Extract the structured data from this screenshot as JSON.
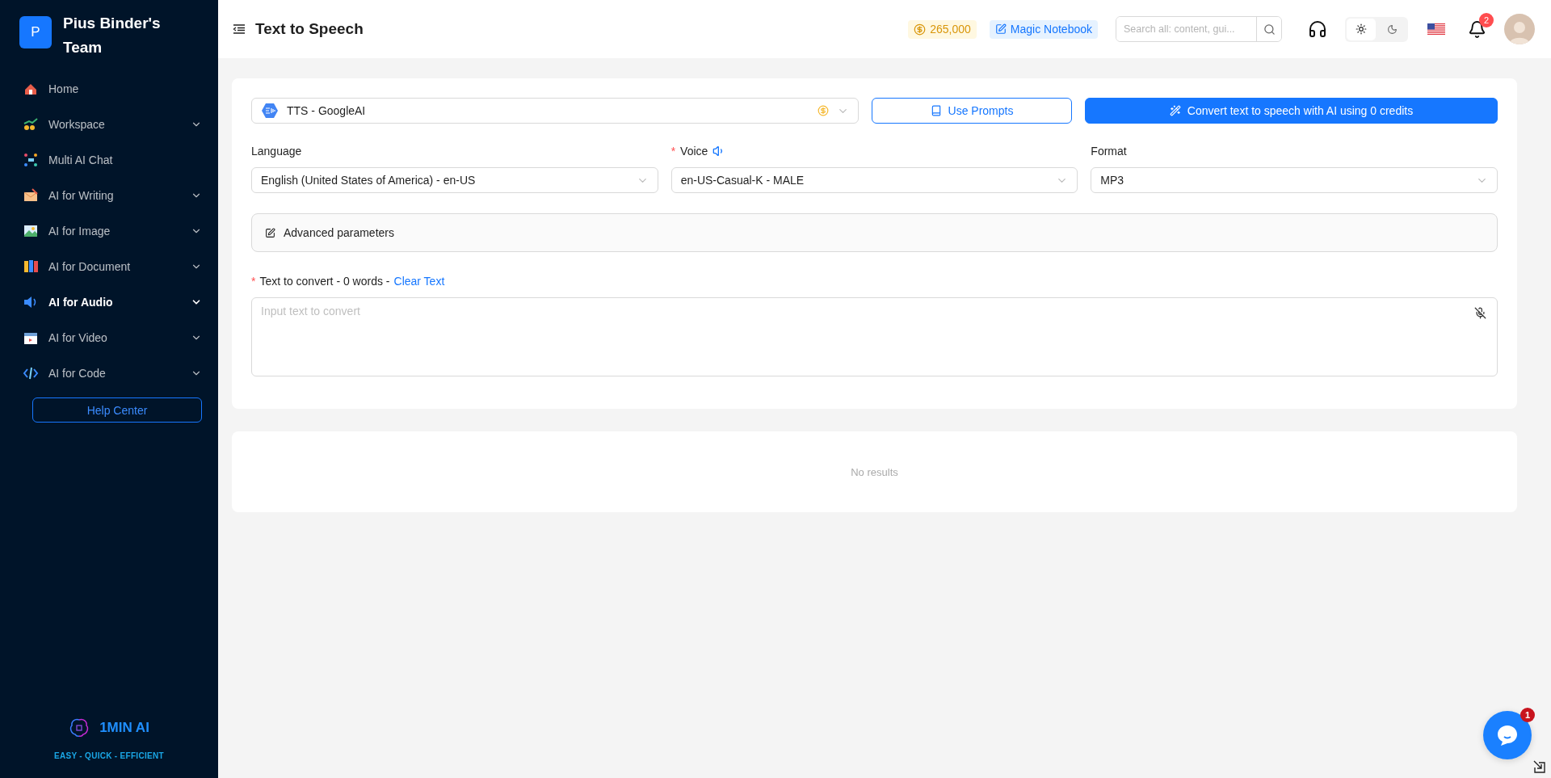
{
  "sidebar": {
    "team_initial": "P",
    "team_name": "Pius Binder's Team",
    "items": [
      {
        "label": "Home",
        "has_submenu": false,
        "selected": false
      },
      {
        "label": "Workspace",
        "has_submenu": true,
        "selected": false
      },
      {
        "label": "Multi AI Chat",
        "has_submenu": false,
        "selected": false
      },
      {
        "label": "AI for Writing",
        "has_submenu": true,
        "selected": false
      },
      {
        "label": "AI for Image",
        "has_submenu": true,
        "selected": false
      },
      {
        "label": "AI for Document",
        "has_submenu": true,
        "selected": false
      },
      {
        "label": "AI for Audio",
        "has_submenu": true,
        "selected": true
      },
      {
        "label": "AI for Video",
        "has_submenu": true,
        "selected": false
      },
      {
        "label": "AI for Code",
        "has_submenu": true,
        "selected": false
      }
    ],
    "help_button": "Help Center",
    "brand": {
      "name": "1MIN AI",
      "tagline": "EASY - QUICK - EFFICIENT"
    }
  },
  "header": {
    "title": "Text to Speech",
    "credits": "265,000",
    "notebook": "Magic Notebook",
    "search": {
      "placeholder": "Search all: content, gui..."
    },
    "theme_toggle": [
      {
        "kind": "light",
        "selected": true
      },
      {
        "kind": "dark",
        "selected": false
      }
    ],
    "notifications": "2"
  },
  "form": {
    "model": {
      "value": "TTS - GoogleAI"
    },
    "prompts_button": "Use Prompts",
    "convert_button": "Convert text to speech with AI using 0 credits",
    "fields": [
      {
        "label": "Language",
        "preview": false,
        "value": "English (United States of America) - en-US"
      },
      {
        "required_mark": "*",
        "label": "Voice",
        "preview": true,
        "value": "en-US-Casual-K - MALE"
      },
      {
        "label": "Format",
        "preview": false,
        "value": "MP3"
      }
    ],
    "advanced": "Advanced parameters",
    "text": {
      "required_mark": "*",
      "label": "Text to convert - 0 words -",
      "clear": "Clear Text",
      "placeholder": "Input text to convert"
    }
  },
  "results": {
    "empty": "No results"
  },
  "chat": {
    "badge": "1"
  }
}
